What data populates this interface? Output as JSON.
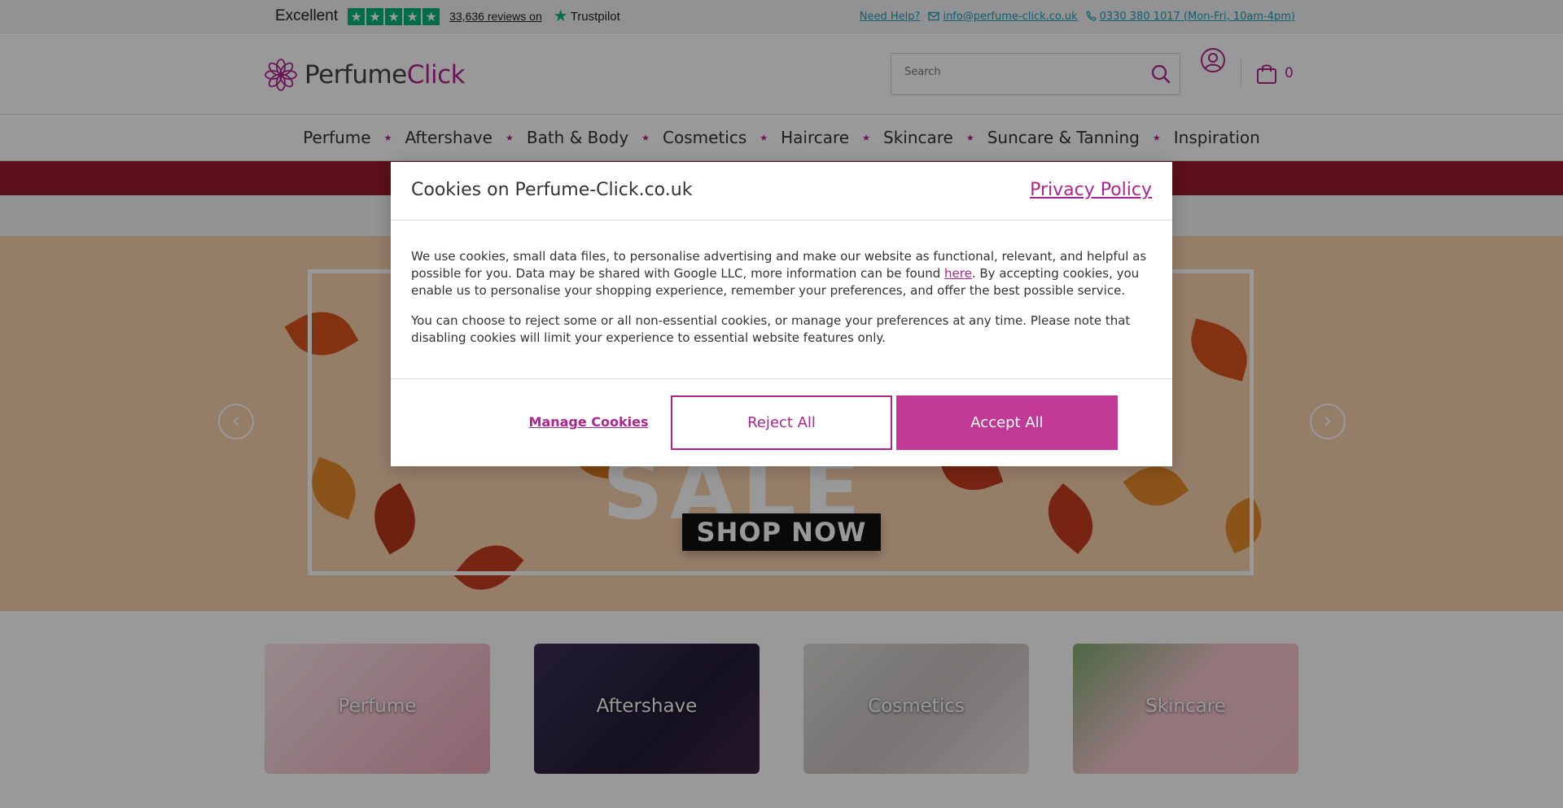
{
  "trustbar": {
    "excellent": "Excellent",
    "reviews": "33,636 reviews on",
    "brand": "Trustpilot"
  },
  "help": {
    "need_help": "Need Help?",
    "email": "info@perfume-click.co.uk",
    "phone": "0330 380 1017 (Mon-Fri, 10am-4pm)"
  },
  "header": {
    "logo_perfume": "Perfume",
    "logo_click": "Click",
    "search_placeholder": "Search",
    "basket_count": "0"
  },
  "nav": {
    "items": [
      "Perfume",
      "Aftershave",
      "Bath & Body",
      "Cosmetics",
      "Haircare",
      "Skincare",
      "Suncare & Tanning",
      "Inspiration"
    ]
  },
  "hero": {
    "headline": "SALE",
    "cta": "SHOP NOW"
  },
  "categories": [
    "Perfume",
    "Aftershave",
    "Cosmetics",
    "Skincare"
  ],
  "cookie": {
    "title": "Cookies on Perfume-Click.co.uk",
    "privacy_link": "Privacy Policy",
    "para1_before": "We use cookies, small data files, to personalise advertising and make our website as functional, relevant, and helpful as possible for you. Data may be shared with Google LLC, more information can be found ",
    "para1_link": "here",
    "para1_after": ". By accepting cookies, you enable us to personalise your shopping experience, remember your preferences, and offer the best possible service.",
    "para2": "You can choose to reject some or all non-essential cookies, or manage your preferences at any time. Please note that disabling cookies will limit your experience to essential website features only.",
    "manage": "Manage Cookies",
    "reject": "Reject All",
    "accept": "Accept All"
  },
  "colors": {
    "brand": "#b0248f",
    "accept_bg": "#c13995",
    "trustpilot_green": "#00b67a",
    "promo_bar": "#9a1b2a",
    "hero_bg": "#f8d2ae"
  }
}
